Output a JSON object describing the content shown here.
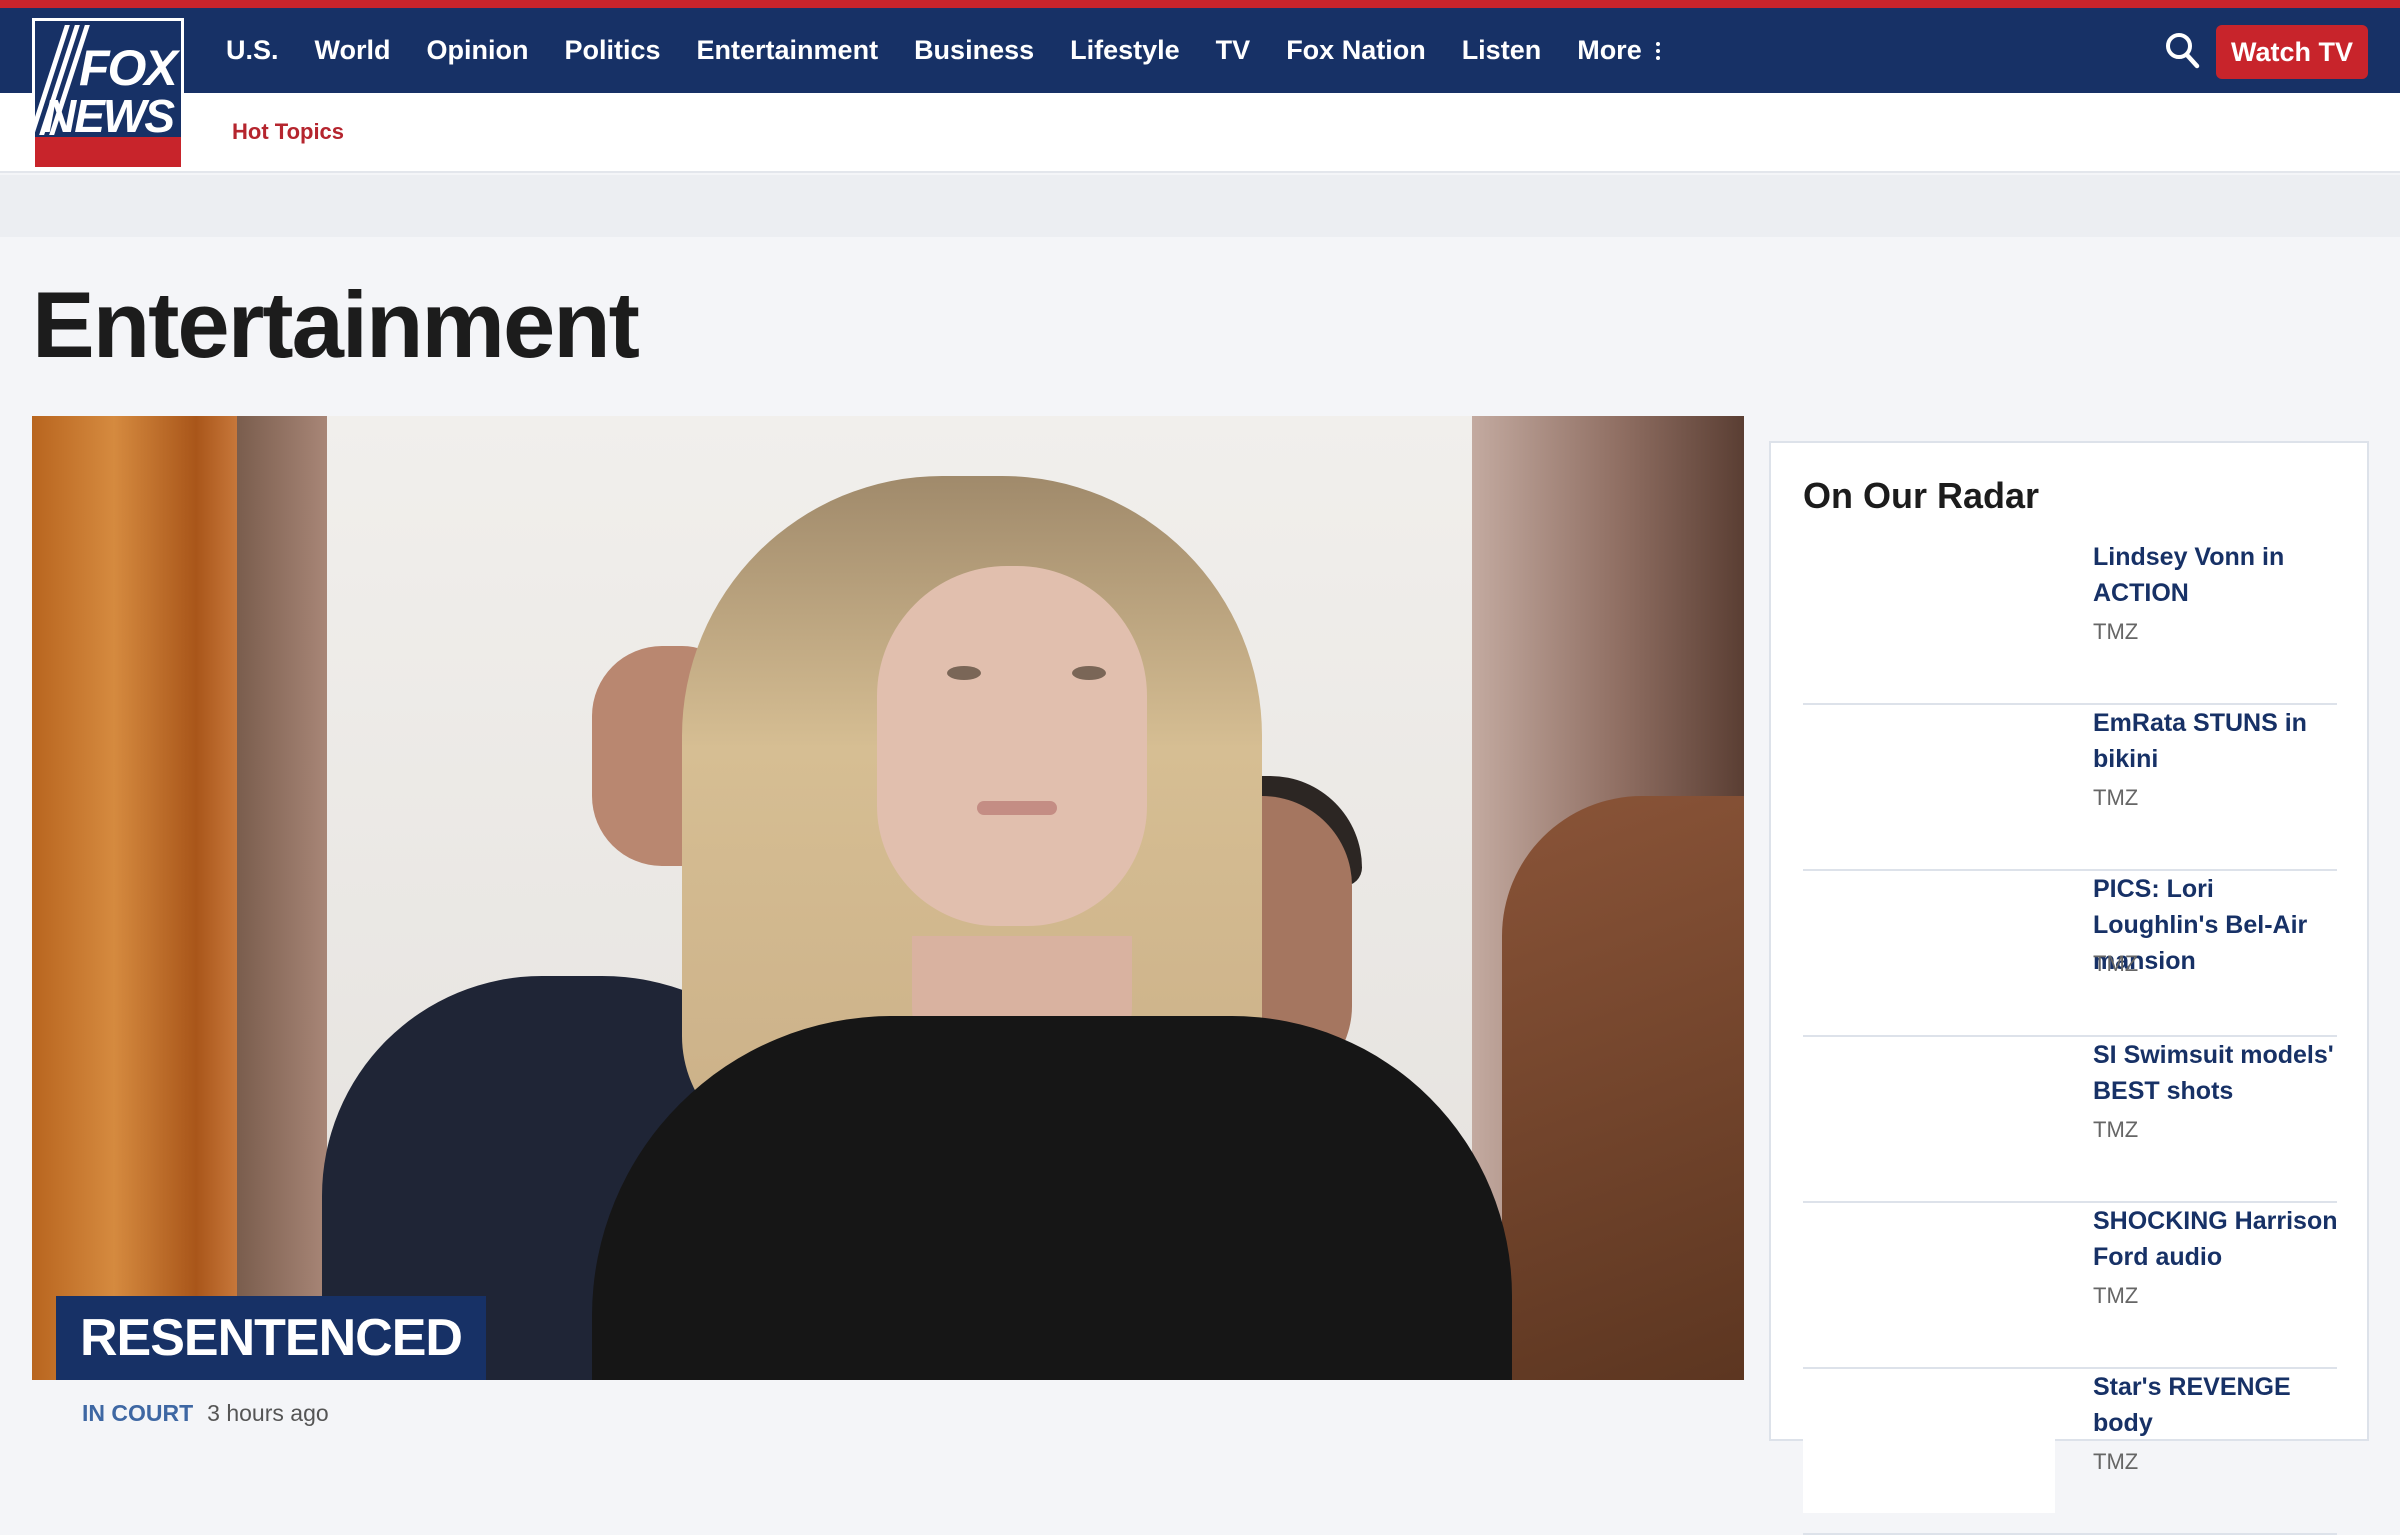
{
  "header": {
    "logo_text_top": "FOX",
    "logo_text_bottom": "NEWS",
    "nav_items": [
      "U.S.",
      "World",
      "Opinion",
      "Politics",
      "Entertainment",
      "Business",
      "Lifestyle",
      "TV",
      "Fox Nation",
      "Listen"
    ],
    "more_label": "More",
    "watch_tv_label": "Watch TV",
    "hot_topics_label": "Hot Topics",
    "colors": {
      "navy": "#173166",
      "red": "#c8242b"
    }
  },
  "page": {
    "title": "Entertainment"
  },
  "hero": {
    "label": "RESENTENCED",
    "category": "IN COURT",
    "time": "3 hours ago"
  },
  "sidebar": {
    "title": "On Our Radar",
    "items": [
      {
        "headline": "Lindsey Vonn in ACTION",
        "source": "TMZ"
      },
      {
        "headline": "EmRata STUNS in bikini",
        "source": "TMZ"
      },
      {
        "headline": "PICS: Lori Loughlin's Bel-Air mansion",
        "source": "TMZ"
      },
      {
        "headline": "SI Swimsuit models' BEST shots",
        "source": "TMZ"
      },
      {
        "headline": "SHOCKING Harrison Ford audio",
        "source": "TMZ"
      },
      {
        "headline": "Star's REVENGE body",
        "source": "TMZ"
      }
    ]
  }
}
